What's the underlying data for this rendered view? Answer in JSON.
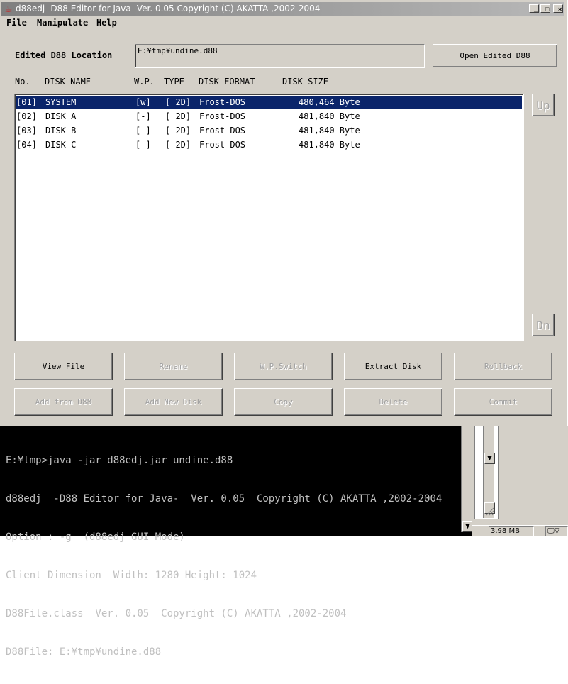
{
  "window": {
    "title": "d88edj  -D88 Editor for Java-  Ver. 0.05  Copyright (C) AKATTA ,2002-2004",
    "minimize": "_",
    "maximize": "□",
    "close": "×"
  },
  "menu": [
    "File",
    "Manipulate",
    "Help"
  ],
  "location": {
    "label": "Edited D88 Location",
    "value": "E:¥tmp¥undine.d88",
    "open_button": "Open Edited D88"
  },
  "columns": [
    "No.",
    "DISK NAME",
    "W.P.",
    "TYPE",
    "DISK FORMAT",
    "DISK SIZE"
  ],
  "disks": [
    {
      "no": "[01]",
      "name": "SYSTEM",
      "wp": "[w]",
      "type": "[ 2D]",
      "format": "Frost-DOS",
      "size": "480,464 Byte",
      "selected": true
    },
    {
      "no": "[02]",
      "name": "DISK A",
      "wp": "[-]",
      "type": "[ 2D]",
      "format": "Frost-DOS",
      "size": "481,840 Byte",
      "selected": false
    },
    {
      "no": "[03]",
      "name": "DISK B",
      "wp": "[-]",
      "type": "[ 2D]",
      "format": "Frost-DOS",
      "size": "481,840 Byte",
      "selected": false
    },
    {
      "no": "[04]",
      "name": "DISK C",
      "wp": "[-]",
      "type": "[ 2D]",
      "format": "Frost-DOS",
      "size": "481,840 Byte",
      "selected": false
    }
  ],
  "side_buttons": {
    "up": "Up",
    "down": "Dn"
  },
  "buttons_row1": [
    {
      "label": "View File",
      "enabled": true
    },
    {
      "label": "Rename",
      "enabled": false
    },
    {
      "label": "W.P.Switch",
      "enabled": false
    },
    {
      "label": "Extract Disk",
      "enabled": true
    },
    {
      "label": "Rollback",
      "enabled": false
    }
  ],
  "buttons_row2": [
    {
      "label": "Add from D88",
      "enabled": false
    },
    {
      "label": "Add New Disk",
      "enabled": false
    },
    {
      "label": "Copy",
      "enabled": false
    },
    {
      "label": "Delete",
      "enabled": false
    },
    {
      "label": "Commit",
      "enabled": false
    }
  ],
  "console": {
    "lines": [
      "E:¥tmp>java -jar d88edj.jar undine.d88",
      "d88edj  -D88 Editor for Java-  Ver. 0.05  Copyright (C) AKATTA ,2002-2004",
      "Option : -g  (d88edj GUI Mode)",
      "Client Dimension  Width: 1280 Height: 1024",
      "D88File.class  Ver. 0.05  Copyright (C) AKATTA ,2002-2004",
      "D88File: E:¥tmp¥undine.d88"
    ]
  },
  "taskbar": {
    "size": "3.98 MB"
  },
  "colors": {
    "selection": "#0a246a",
    "face": "#d4d0c8",
    "titlebar_inactive": "#808080"
  }
}
